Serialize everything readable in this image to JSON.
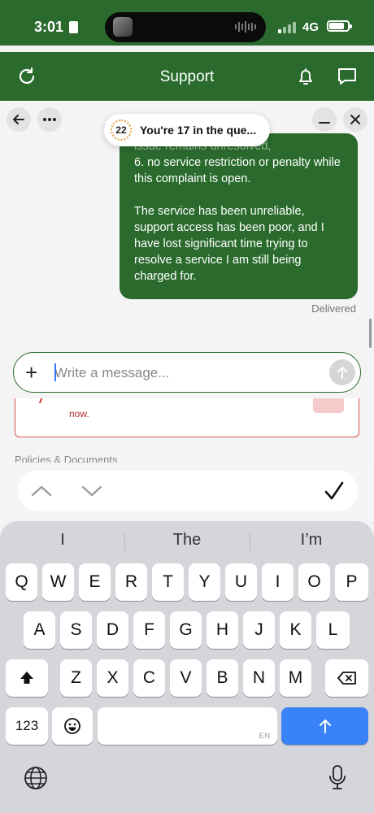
{
  "status_bar": {
    "time": "3:01",
    "network": "4G"
  },
  "header": {
    "title": "Support"
  },
  "queue": {
    "position_badge": "22",
    "text": "You're 17 in the que..."
  },
  "message": {
    "cut_line": "issue remains unresolved,",
    "line_item": "6. no service restriction or penalty while this complaint is open.",
    "paragraph": "The service has been unreliable, support access has been poor, and I have lost significant time trying to resolve a service I am still being charged for.",
    "status": "Delivered"
  },
  "composer": {
    "placeholder": "Write a message...",
    "value": ""
  },
  "alert_card": {
    "text": "now."
  },
  "section_peek": "Policies & Documents",
  "keyboard": {
    "suggestions": [
      "I",
      "The",
      "I’m"
    ],
    "row1": [
      "Q",
      "W",
      "E",
      "R",
      "T",
      "Y",
      "U",
      "I",
      "O",
      "P"
    ],
    "row2": [
      "A",
      "S",
      "D",
      "F",
      "G",
      "H",
      "J",
      "K",
      "L"
    ],
    "row3": [
      "Z",
      "X",
      "C",
      "V",
      "B",
      "N",
      "M"
    ],
    "numbers_key": "123",
    "space_lang": "EN"
  },
  "colors": {
    "brand": "#2a6b2d",
    "key_accent": "#3a82f7",
    "alert": "#d9534f"
  },
  "icons": [
    "refresh-icon",
    "bell-icon",
    "chat-icon",
    "back-arrow-icon",
    "more-icon",
    "minimize-icon",
    "close-icon",
    "plus-icon",
    "send-arrow-icon",
    "chevron-up-icon",
    "chevron-down-icon",
    "checkmark-icon",
    "shift-icon",
    "backspace-icon",
    "emoji-icon",
    "return-arrow-icon",
    "globe-icon",
    "microphone-icon"
  ]
}
